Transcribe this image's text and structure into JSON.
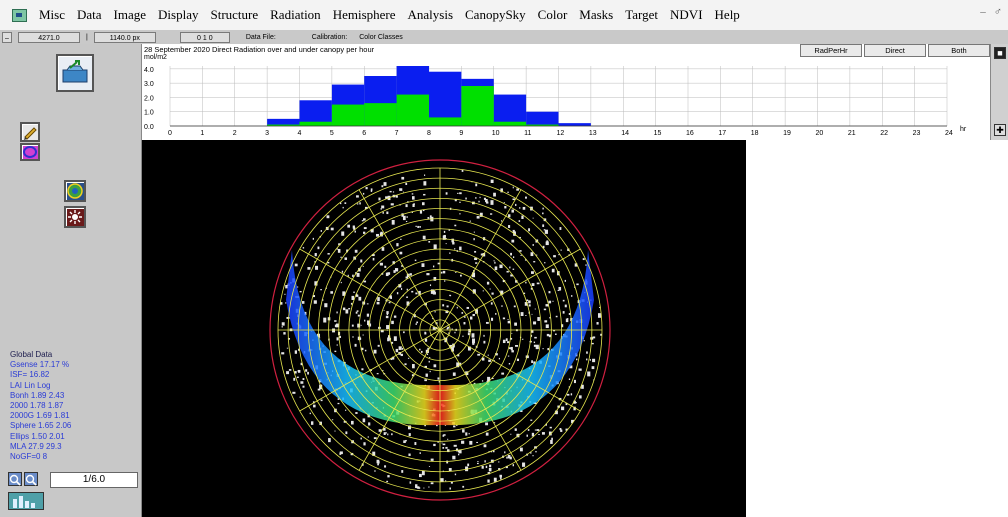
{
  "menu": {
    "items": [
      "Misc",
      "Data",
      "Image",
      "Display",
      "Structure",
      "Radiation",
      "Hemisphere",
      "Analysis",
      "CanopySky",
      "Color",
      "Masks",
      "Target",
      "NDVI",
      "Help"
    ],
    "win_controls": [
      "–",
      "♂"
    ]
  },
  "status": {
    "field1": "4271.0",
    "sep": "|",
    "field2": "1140.0 px",
    "field3": "0 1 0",
    "data_file_label": "Data File:",
    "calibration_label": "Calibration:",
    "color_label": "Color Classes"
  },
  "chart": {
    "title": "28 September 2020  Direct Radiation over and under canopy per hour",
    "unit": "mol/m2",
    "buttons": {
      "radperhr": "RadPerHr",
      "direct": "Direct",
      "both": "Both"
    },
    "right_tail": "hr"
  },
  "chart_data": {
    "type": "bar",
    "title": "28 September 2020  Direct Radiation over and under canopy per hour",
    "ylabel": "mol/m2",
    "xlabel": "",
    "ylim": [
      0,
      4.2
    ],
    "yticks": [
      "4.0",
      "3.0",
      "2.0",
      "1.0",
      "0.0"
    ],
    "x": [
      0,
      1,
      2,
      3,
      4,
      5,
      6,
      7,
      8,
      9,
      10,
      11,
      12,
      13,
      14,
      15,
      16,
      17,
      18,
      19,
      20,
      21,
      22,
      23,
      24
    ],
    "series": [
      {
        "color": "#0a1ef0",
        "values": [
          0,
          0,
          0,
          0.5,
          1.8,
          2.9,
          3.5,
          4.2,
          3.8,
          3.3,
          2.2,
          1.0,
          0.2,
          0,
          0,
          0,
          0,
          0,
          0,
          0,
          0,
          0,
          0,
          0
        ]
      },
      {
        "color": "#00e000",
        "values": [
          0,
          0,
          0,
          0.1,
          0.3,
          1.5,
          1.6,
          2.2,
          0.6,
          2.8,
          0.3,
          0.1,
          0,
          0,
          0,
          0,
          0,
          0,
          0,
          0,
          0,
          0,
          0,
          0
        ]
      }
    ],
    "grid": true
  },
  "sidebar": {
    "global_title": "Global Data",
    "lines": [
      "Gsense  17.17 %",
      "ISF=  16.82",
      "LAI   Lin Log",
      "Bonh 1.89 2.43",
      "2000  1.78 1.87",
      "2000G  1.69 1.81",
      "Sphere 1.65 2.06",
      "Ellips 1.50 2.01",
      "MLA   27.9 29.3",
      "NoGF=0  8"
    ],
    "zoom_value": "1/6.0"
  },
  "image": {
    "overlay_ticks": "10 20 30 40 50 60 70 80 90"
  },
  "colors": {
    "accent": "#0a1ef0",
    "under_canopy": "#00e000",
    "panel": "#c8c8c8"
  }
}
